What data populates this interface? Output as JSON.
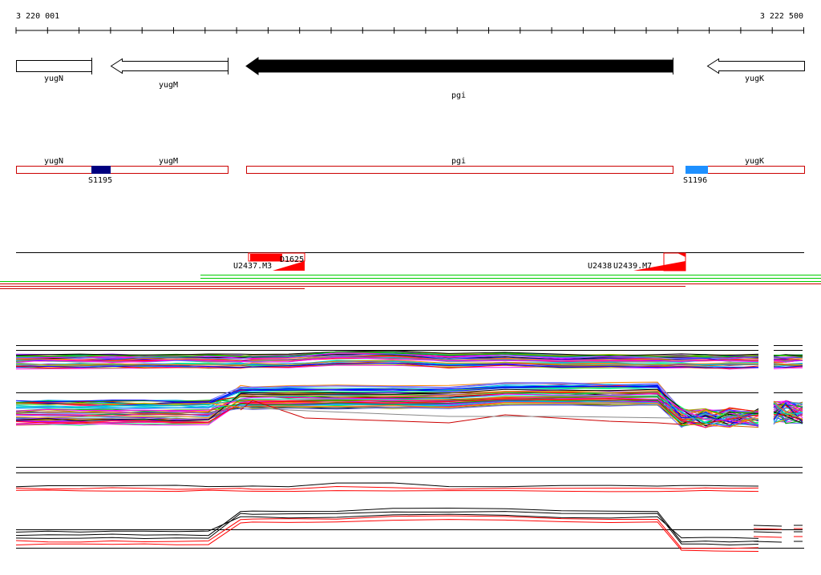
{
  "coordinates": {
    "start_label": "3 220 001",
    "end_label": "3 222 500"
  },
  "genes": [
    {
      "name": "yugN",
      "strand": "-",
      "highlighted": false
    },
    {
      "name": "yugM",
      "strand": "-",
      "highlighted": false
    },
    {
      "name": "pgi",
      "strand": "-",
      "highlighted": true
    },
    {
      "name": "yugK",
      "strand": "-",
      "highlighted": false
    }
  ],
  "regions": [
    {
      "name": "S1195",
      "color": "#000080"
    },
    {
      "name": "S1196",
      "color": "#1e90ff"
    }
  ],
  "feature_labels": {
    "d1625": "D1625",
    "u2437": "U2437.M3",
    "u2438": "U2438",
    "u2439": "U2439.M7"
  },
  "colors": {
    "gene_outline": "#000000",
    "gene_highlight": "#000000",
    "region_bar_outline": "#cc0000",
    "feature_red": "#ff0000",
    "track_green": "#00cc00",
    "track_red": "#cc0000"
  }
}
